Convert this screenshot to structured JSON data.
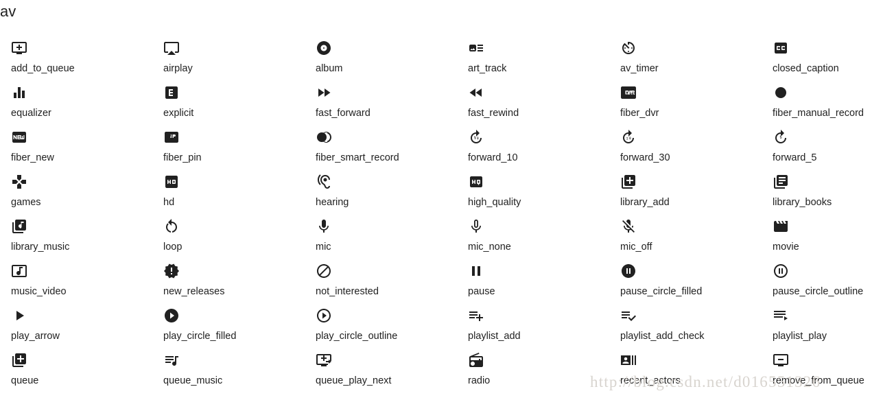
{
  "page": {
    "category_title": "av",
    "watermark": "http://blog.csdn.net/d016551326",
    "columns": 6,
    "text_color": "#212121",
    "background_color": "#ffffff"
  },
  "icons": [
    {
      "name": "add_to_queue",
      "glyph": "add-to-queue-icon"
    },
    {
      "name": "airplay",
      "glyph": "airplay-icon"
    },
    {
      "name": "album",
      "glyph": "album-icon"
    },
    {
      "name": "art_track",
      "glyph": "art-track-icon"
    },
    {
      "name": "av_timer",
      "glyph": "av-timer-icon"
    },
    {
      "name": "closed_caption",
      "glyph": "closed-caption-icon"
    },
    {
      "name": "equalizer",
      "glyph": "equalizer-icon"
    },
    {
      "name": "explicit",
      "glyph": "explicit-icon"
    },
    {
      "name": "fast_forward",
      "glyph": "fast-forward-icon"
    },
    {
      "name": "fast_rewind",
      "glyph": "fast-rewind-icon"
    },
    {
      "name": "fiber_dvr",
      "glyph": "fiber-dvr-icon"
    },
    {
      "name": "fiber_manual_record",
      "glyph": "fiber-manual-record-icon"
    },
    {
      "name": "fiber_new",
      "glyph": "fiber-new-icon"
    },
    {
      "name": "fiber_pin",
      "glyph": "fiber-pin-icon"
    },
    {
      "name": "fiber_smart_record",
      "glyph": "fiber-smart-record-icon"
    },
    {
      "name": "forward_10",
      "glyph": "forward-10-icon"
    },
    {
      "name": "forward_30",
      "glyph": "forward-30-icon"
    },
    {
      "name": "forward_5",
      "glyph": "forward-5-icon"
    },
    {
      "name": "games",
      "glyph": "games-icon"
    },
    {
      "name": "hd",
      "glyph": "hd-icon"
    },
    {
      "name": "hearing",
      "glyph": "hearing-icon"
    },
    {
      "name": "high_quality",
      "glyph": "high-quality-icon"
    },
    {
      "name": "library_add",
      "glyph": "library-add-icon"
    },
    {
      "name": "library_books",
      "glyph": "library-books-icon"
    },
    {
      "name": "library_music",
      "glyph": "library-music-icon"
    },
    {
      "name": "loop",
      "glyph": "loop-icon"
    },
    {
      "name": "mic",
      "glyph": "mic-icon"
    },
    {
      "name": "mic_none",
      "glyph": "mic-none-icon"
    },
    {
      "name": "mic_off",
      "glyph": "mic-off-icon"
    },
    {
      "name": "movie",
      "glyph": "movie-icon"
    },
    {
      "name": "music_video",
      "glyph": "music-video-icon"
    },
    {
      "name": "new_releases",
      "glyph": "new-releases-icon"
    },
    {
      "name": "not_interested",
      "glyph": "not-interested-icon"
    },
    {
      "name": "pause",
      "glyph": "pause-icon"
    },
    {
      "name": "pause_circle_filled",
      "glyph": "pause-circle-filled-icon"
    },
    {
      "name": "pause_circle_outline",
      "glyph": "pause-circle-outline-icon"
    },
    {
      "name": "play_arrow",
      "glyph": "play-arrow-icon"
    },
    {
      "name": "play_circle_filled",
      "glyph": "play-circle-filled-icon"
    },
    {
      "name": "play_circle_outline",
      "glyph": "play-circle-outline-icon"
    },
    {
      "name": "playlist_add",
      "glyph": "playlist-add-icon"
    },
    {
      "name": "playlist_add_check",
      "glyph": "playlist-add-check-icon"
    },
    {
      "name": "playlist_play",
      "glyph": "playlist-play-icon"
    },
    {
      "name": "queue",
      "glyph": "queue-icon"
    },
    {
      "name": "queue_music",
      "glyph": "queue-music-icon"
    },
    {
      "name": "queue_play_next",
      "glyph": "queue-play-next-icon"
    },
    {
      "name": "radio",
      "glyph": "radio-icon"
    },
    {
      "name": "recent_actors",
      "glyph": "recent-actors-icon"
    },
    {
      "name": "remove_from_queue",
      "glyph": "remove-from-queue-icon"
    }
  ]
}
